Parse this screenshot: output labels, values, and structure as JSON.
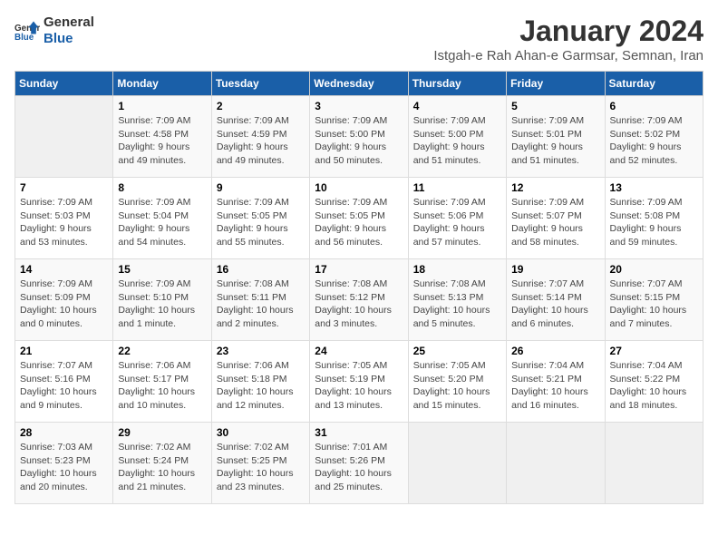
{
  "logo": {
    "text_general": "General",
    "text_blue": "Blue"
  },
  "title": "January 2024",
  "location": "Istgah-e Rah Ahan-e Garmsar, Semnan, Iran",
  "weekdays": [
    "Sunday",
    "Monday",
    "Tuesday",
    "Wednesday",
    "Thursday",
    "Friday",
    "Saturday"
  ],
  "weeks": [
    [
      {
        "day": "",
        "sunrise": "",
        "sunset": "",
        "daylight": ""
      },
      {
        "day": "1",
        "sunrise": "Sunrise: 7:09 AM",
        "sunset": "Sunset: 4:58 PM",
        "daylight": "Daylight: 9 hours and 49 minutes."
      },
      {
        "day": "2",
        "sunrise": "Sunrise: 7:09 AM",
        "sunset": "Sunset: 4:59 PM",
        "daylight": "Daylight: 9 hours and 49 minutes."
      },
      {
        "day": "3",
        "sunrise": "Sunrise: 7:09 AM",
        "sunset": "Sunset: 5:00 PM",
        "daylight": "Daylight: 9 hours and 50 minutes."
      },
      {
        "day": "4",
        "sunrise": "Sunrise: 7:09 AM",
        "sunset": "Sunset: 5:00 PM",
        "daylight": "Daylight: 9 hours and 51 minutes."
      },
      {
        "day": "5",
        "sunrise": "Sunrise: 7:09 AM",
        "sunset": "Sunset: 5:01 PM",
        "daylight": "Daylight: 9 hours and 51 minutes."
      },
      {
        "day": "6",
        "sunrise": "Sunrise: 7:09 AM",
        "sunset": "Sunset: 5:02 PM",
        "daylight": "Daylight: 9 hours and 52 minutes."
      }
    ],
    [
      {
        "day": "7",
        "sunrise": "Sunrise: 7:09 AM",
        "sunset": "Sunset: 5:03 PM",
        "daylight": "Daylight: 9 hours and 53 minutes."
      },
      {
        "day": "8",
        "sunrise": "Sunrise: 7:09 AM",
        "sunset": "Sunset: 5:04 PM",
        "daylight": "Daylight: 9 hours and 54 minutes."
      },
      {
        "day": "9",
        "sunrise": "Sunrise: 7:09 AM",
        "sunset": "Sunset: 5:05 PM",
        "daylight": "Daylight: 9 hours and 55 minutes."
      },
      {
        "day": "10",
        "sunrise": "Sunrise: 7:09 AM",
        "sunset": "Sunset: 5:05 PM",
        "daylight": "Daylight: 9 hours and 56 minutes."
      },
      {
        "day": "11",
        "sunrise": "Sunrise: 7:09 AM",
        "sunset": "Sunset: 5:06 PM",
        "daylight": "Daylight: 9 hours and 57 minutes."
      },
      {
        "day": "12",
        "sunrise": "Sunrise: 7:09 AM",
        "sunset": "Sunset: 5:07 PM",
        "daylight": "Daylight: 9 hours and 58 minutes."
      },
      {
        "day": "13",
        "sunrise": "Sunrise: 7:09 AM",
        "sunset": "Sunset: 5:08 PM",
        "daylight": "Daylight: 9 hours and 59 minutes."
      }
    ],
    [
      {
        "day": "14",
        "sunrise": "Sunrise: 7:09 AM",
        "sunset": "Sunset: 5:09 PM",
        "daylight": "Daylight: 10 hours and 0 minutes."
      },
      {
        "day": "15",
        "sunrise": "Sunrise: 7:09 AM",
        "sunset": "Sunset: 5:10 PM",
        "daylight": "Daylight: 10 hours and 1 minute."
      },
      {
        "day": "16",
        "sunrise": "Sunrise: 7:08 AM",
        "sunset": "Sunset: 5:11 PM",
        "daylight": "Daylight: 10 hours and 2 minutes."
      },
      {
        "day": "17",
        "sunrise": "Sunrise: 7:08 AM",
        "sunset": "Sunset: 5:12 PM",
        "daylight": "Daylight: 10 hours and 3 minutes."
      },
      {
        "day": "18",
        "sunrise": "Sunrise: 7:08 AM",
        "sunset": "Sunset: 5:13 PM",
        "daylight": "Daylight: 10 hours and 5 minutes."
      },
      {
        "day": "19",
        "sunrise": "Sunrise: 7:07 AM",
        "sunset": "Sunset: 5:14 PM",
        "daylight": "Daylight: 10 hours and 6 minutes."
      },
      {
        "day": "20",
        "sunrise": "Sunrise: 7:07 AM",
        "sunset": "Sunset: 5:15 PM",
        "daylight": "Daylight: 10 hours and 7 minutes."
      }
    ],
    [
      {
        "day": "21",
        "sunrise": "Sunrise: 7:07 AM",
        "sunset": "Sunset: 5:16 PM",
        "daylight": "Daylight: 10 hours and 9 minutes."
      },
      {
        "day": "22",
        "sunrise": "Sunrise: 7:06 AM",
        "sunset": "Sunset: 5:17 PM",
        "daylight": "Daylight: 10 hours and 10 minutes."
      },
      {
        "day": "23",
        "sunrise": "Sunrise: 7:06 AM",
        "sunset": "Sunset: 5:18 PM",
        "daylight": "Daylight: 10 hours and 12 minutes."
      },
      {
        "day": "24",
        "sunrise": "Sunrise: 7:05 AM",
        "sunset": "Sunset: 5:19 PM",
        "daylight": "Daylight: 10 hours and 13 minutes."
      },
      {
        "day": "25",
        "sunrise": "Sunrise: 7:05 AM",
        "sunset": "Sunset: 5:20 PM",
        "daylight": "Daylight: 10 hours and 15 minutes."
      },
      {
        "day": "26",
        "sunrise": "Sunrise: 7:04 AM",
        "sunset": "Sunset: 5:21 PM",
        "daylight": "Daylight: 10 hours and 16 minutes."
      },
      {
        "day": "27",
        "sunrise": "Sunrise: 7:04 AM",
        "sunset": "Sunset: 5:22 PM",
        "daylight": "Daylight: 10 hours and 18 minutes."
      }
    ],
    [
      {
        "day": "28",
        "sunrise": "Sunrise: 7:03 AM",
        "sunset": "Sunset: 5:23 PM",
        "daylight": "Daylight: 10 hours and 20 minutes."
      },
      {
        "day": "29",
        "sunrise": "Sunrise: 7:02 AM",
        "sunset": "Sunset: 5:24 PM",
        "daylight": "Daylight: 10 hours and 21 minutes."
      },
      {
        "day": "30",
        "sunrise": "Sunrise: 7:02 AM",
        "sunset": "Sunset: 5:25 PM",
        "daylight": "Daylight: 10 hours and 23 minutes."
      },
      {
        "day": "31",
        "sunrise": "Sunrise: 7:01 AM",
        "sunset": "Sunset: 5:26 PM",
        "daylight": "Daylight: 10 hours and 25 minutes."
      },
      {
        "day": "",
        "sunrise": "",
        "sunset": "",
        "daylight": ""
      },
      {
        "day": "",
        "sunrise": "",
        "sunset": "",
        "daylight": ""
      },
      {
        "day": "",
        "sunrise": "",
        "sunset": "",
        "daylight": ""
      }
    ]
  ]
}
